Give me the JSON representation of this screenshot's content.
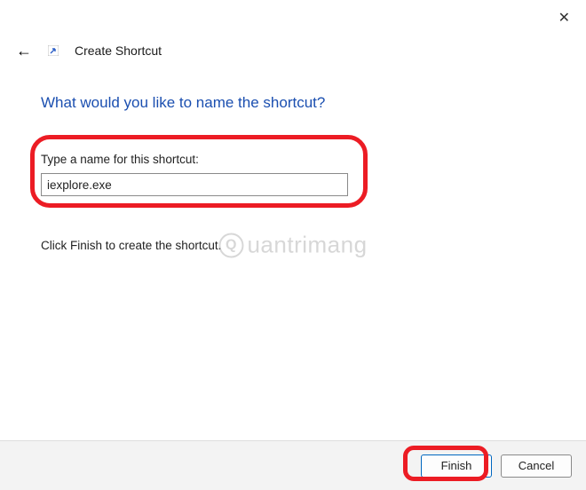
{
  "window": {
    "close_symbol": "✕",
    "back_symbol": "←",
    "title": "Create Shortcut"
  },
  "content": {
    "heading": "What would you like to name the shortcut?",
    "label": "Type a name for this shortcut:",
    "input_value": "iexplore.exe",
    "hint": "Click Finish to create the shortcut."
  },
  "footer": {
    "finish_label": "Finish",
    "cancel_label": "Cancel"
  },
  "watermark": {
    "symbol": "Q",
    "text": "uantrimang"
  }
}
